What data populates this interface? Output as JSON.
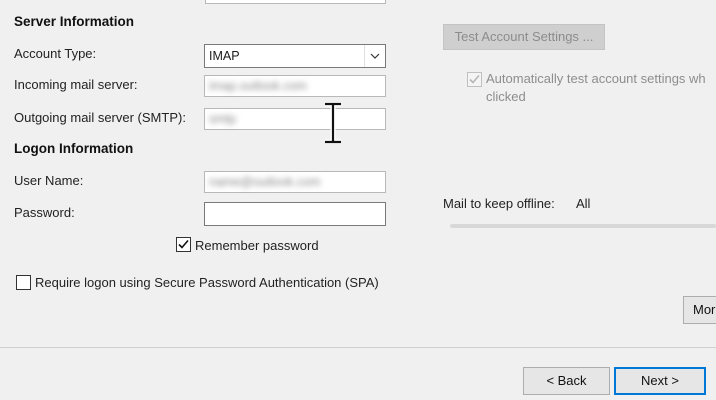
{
  "server": {
    "section_title": "Server Information",
    "account_type_label": "Account Type:",
    "account_type_value": "IMAP",
    "incoming_label": "Incoming mail server:",
    "incoming_value": "imap.outlook.com",
    "outgoing_label": "Outgoing mail server (SMTP):",
    "outgoing_value": "smtp"
  },
  "logon": {
    "section_title": "Logon Information",
    "username_label": "User Name:",
    "username_value": "name@outlook.com",
    "password_label": "Password:",
    "password_value": "",
    "remember_label": "Remember password",
    "spa_label": "Require logon using Secure Password Authentication (SPA)"
  },
  "test": {
    "button_label": "Test Account Settings ...",
    "auto_test_line1": "Automatically test account settings wh",
    "auto_test_line2": "clicked"
  },
  "offline": {
    "label": "Mail to keep offline:",
    "value": "All"
  },
  "more_button_label": "Mor",
  "nav": {
    "back_label": "< Back",
    "next_label": "Next >"
  },
  "colors": {
    "background": "#f0f0f0",
    "accent": "#0078d7"
  }
}
